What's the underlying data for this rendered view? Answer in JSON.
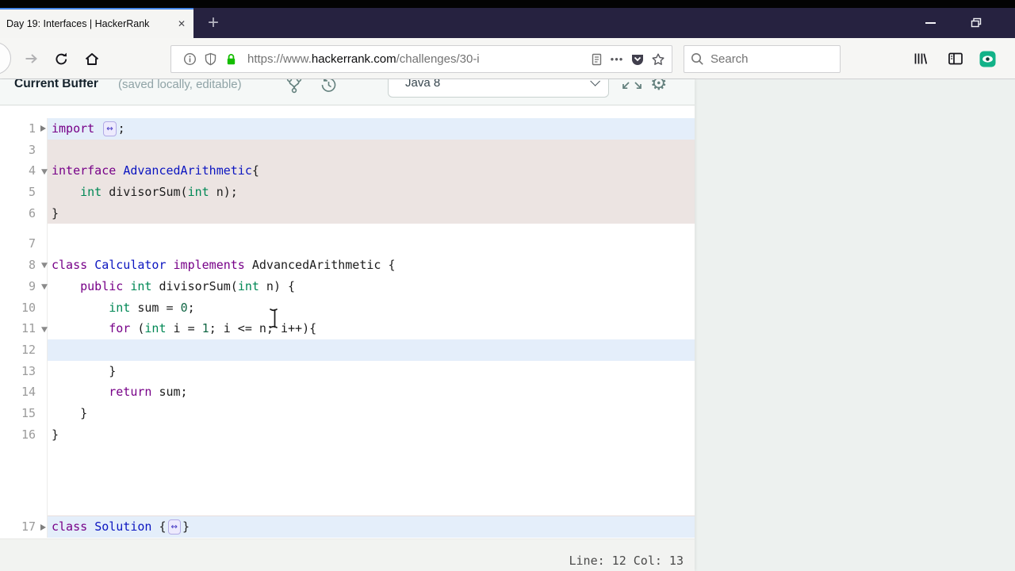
{
  "browser": {
    "tab": {
      "title": "Day 19: Interfaces | HackerRank",
      "close_glyph": "✕"
    },
    "new_tab_glyph": "+",
    "nav": {
      "url": {
        "scheme": "https://www.",
        "domain": "hackerrank.com",
        "path": "/challenges/30-i"
      },
      "page_actions_glyph": "•••",
      "search_placeholder": "Search"
    }
  },
  "editor": {
    "header": {
      "title": "Current Buffer",
      "subtitle": "(saved locally, editable)",
      "language": "Java 8"
    },
    "icons": {
      "gear_glyph": "⚙"
    },
    "status": {
      "text": "Line: 12 Col: 13",
      "line": 12,
      "col": 13
    },
    "colors": {
      "keyword": "#770088",
      "type": "#008855",
      "number": "#116644",
      "definition": "#0b15c0",
      "active_line_bg": "#e4eefa",
      "locked_region_bg": "#ece4e2",
      "tab_accent": "#4586e8",
      "lock_green": "#14bd00"
    },
    "lines": [
      {
        "num": "1",
        "fold": "collapsed",
        "bg": "active",
        "tokens": [
          [
            "k",
            "import"
          ],
          [
            "p",
            " "
          ],
          [
            "w",
            "↔"
          ],
          [
            "p",
            ";"
          ]
        ]
      },
      {
        "num": "3",
        "bg": "locked",
        "tokens": []
      },
      {
        "num": "4",
        "fold": "open",
        "bg": "locked",
        "tokens": [
          [
            "k",
            "interface"
          ],
          [
            "p",
            " "
          ],
          [
            "d",
            "AdvancedArithmetic"
          ],
          [
            "p",
            "{"
          ]
        ]
      },
      {
        "num": "5",
        "bg": "locked",
        "tokens": [
          [
            "p",
            "    "
          ],
          [
            "t",
            "int"
          ],
          [
            "p",
            " divisorSum("
          ],
          [
            "t",
            "int"
          ],
          [
            "p",
            " n);"
          ]
        ]
      },
      {
        "num": "6",
        "bg": "locked",
        "tokens": [
          [
            "p",
            "}"
          ]
        ]
      },
      {
        "spacer": 12
      },
      {
        "num": "7",
        "tokens": []
      },
      {
        "num": "8",
        "fold": "open",
        "tokens": [
          [
            "k",
            "class"
          ],
          [
            "p",
            " "
          ],
          [
            "d",
            "Calculator"
          ],
          [
            "p",
            " "
          ],
          [
            "k",
            "implements"
          ],
          [
            "p",
            " AdvancedArithmetic {"
          ]
        ]
      },
      {
        "num": "9",
        "fold": "open",
        "tokens": [
          [
            "p",
            "    "
          ],
          [
            "k",
            "public"
          ],
          [
            "p",
            " "
          ],
          [
            "t",
            "int"
          ],
          [
            "p",
            " divisorSum("
          ],
          [
            "t",
            "int"
          ],
          [
            "p",
            " n) {"
          ]
        ]
      },
      {
        "num": "10",
        "tokens": [
          [
            "p",
            "        "
          ],
          [
            "t",
            "int"
          ],
          [
            "p",
            " sum = "
          ],
          [
            "n",
            "0"
          ],
          [
            "p",
            ";"
          ]
        ]
      },
      {
        "num": "11",
        "fold": "open",
        "tokens": [
          [
            "p",
            "        "
          ],
          [
            "k",
            "for"
          ],
          [
            "p",
            " ("
          ],
          [
            "t",
            "int"
          ],
          [
            "p",
            " i = "
          ],
          [
            "n",
            "1"
          ],
          [
            "p",
            "; i <= n; i++){"
          ]
        ]
      },
      {
        "num": "12",
        "bg": "active",
        "tokens": []
      },
      {
        "num": "13",
        "tokens": [
          [
            "p",
            "        }"
          ]
        ]
      },
      {
        "num": "14",
        "tokens": [
          [
            "p",
            "        "
          ],
          [
            "k",
            "return"
          ],
          [
            "p",
            " sum;"
          ]
        ]
      },
      {
        "num": "15",
        "tokens": [
          [
            "p",
            "    }"
          ]
        ]
      },
      {
        "num": "16",
        "tokens": [
          [
            "p",
            "}"
          ]
        ]
      },
      {
        "filler": 90
      },
      {
        "num": "17",
        "fold": "collapsed",
        "bg": "active",
        "sep": true,
        "tokens": [
          [
            "k",
            "class"
          ],
          [
            "p",
            " "
          ],
          [
            "d",
            "Solution"
          ],
          [
            "p",
            " {"
          ],
          [
            "w",
            "↔"
          ],
          [
            "p",
            "}"
          ]
        ]
      }
    ]
  }
}
